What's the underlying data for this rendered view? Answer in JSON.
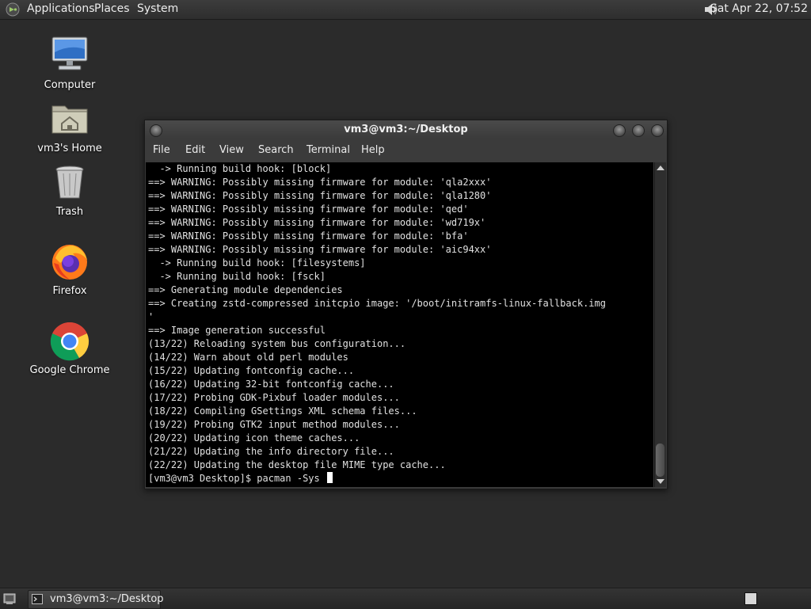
{
  "top_panel": {
    "menus": [
      "Applications",
      "Places",
      "System"
    ],
    "clock": "Sat Apr 22, 07:52",
    "logo_icon": "gnome-foot-icon",
    "volume_icon": "speaker-icon"
  },
  "desktop": {
    "icons": [
      {
        "label": "Computer",
        "icon": "computer-icon"
      },
      {
        "label": "vm3's Home",
        "icon": "home-folder-icon"
      },
      {
        "label": "Trash",
        "icon": "trash-icon"
      },
      {
        "label": "Firefox",
        "icon": "firefox-icon"
      },
      {
        "label": "Google Chrome",
        "icon": "chrome-icon"
      }
    ]
  },
  "terminal": {
    "title": "vm3@vm3:~/Desktop",
    "menu": [
      "File",
      "Edit",
      "View",
      "Search",
      "Terminal",
      "Help"
    ],
    "lines": [
      "  -> Running build hook: [block]",
      "==> WARNING: Possibly missing firmware for module: 'qla2xxx'",
      "==> WARNING: Possibly missing firmware for module: 'qla1280'",
      "==> WARNING: Possibly missing firmware for module: 'qed'",
      "==> WARNING: Possibly missing firmware for module: 'wd719x'",
      "==> WARNING: Possibly missing firmware for module: 'bfa'",
      "==> WARNING: Possibly missing firmware for module: 'aic94xx'",
      "  -> Running build hook: [filesystems]",
      "  -> Running build hook: [fsck]",
      "==> Generating module dependencies",
      "==> Creating zstd-compressed initcpio image: '/boot/initramfs-linux-fallback.img",
      "'",
      "==> Image generation successful",
      "(13/22) Reloading system bus configuration...",
      "(14/22) Warn about old perl modules",
      "(15/22) Updating fontconfig cache...",
      "(16/22) Updating 32-bit fontconfig cache...",
      "(17/22) Probing GDK-Pixbuf loader modules...",
      "(18/22) Compiling GSettings XML schema files...",
      "(19/22) Probing GTK2 input method modules...",
      "(20/22) Updating icon theme caches...",
      "(21/22) Updating the info directory file...",
      "(22/22) Updating the desktop file MIME type cache..."
    ],
    "prompt": "[vm3@vm3 Desktop]$ pacman -Sys "
  },
  "taskbar": {
    "tasks": [
      {
        "label": "vm3@vm3:~/Desktop",
        "icon": "terminal-icon"
      }
    ],
    "show_desktop_icon": "show-desktop-icon",
    "workspace_icon": "workspace-switcher-icon"
  }
}
